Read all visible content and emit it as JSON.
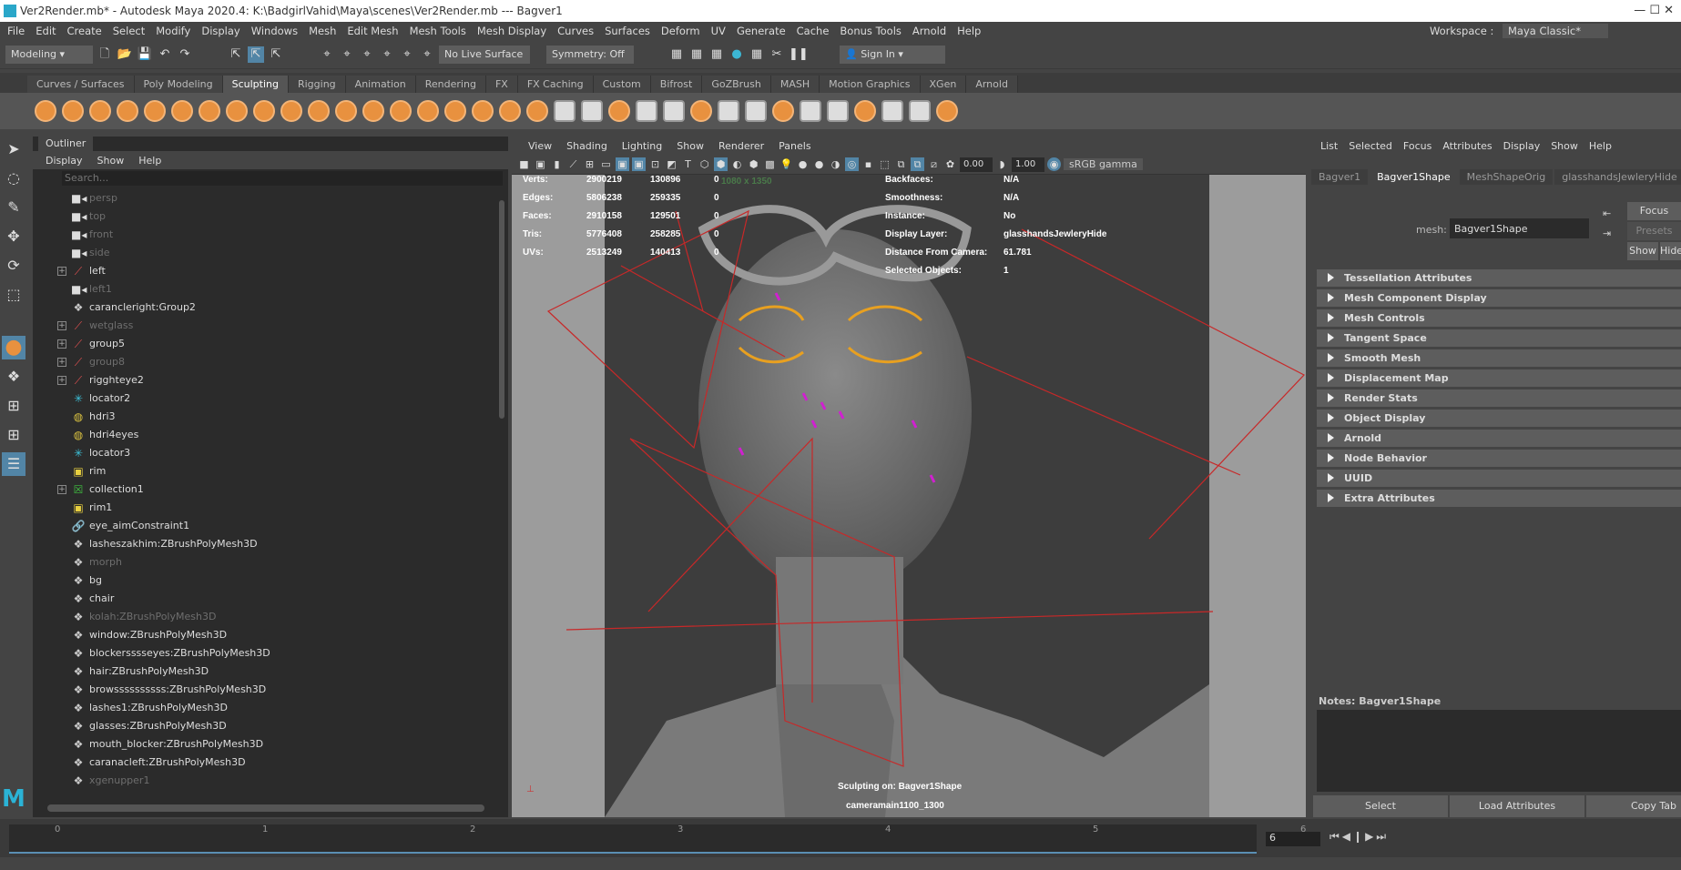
{
  "window": {
    "title": "Ver2Render.mb* - Autodesk Maya 2020.4: K:\\BadgirlVahid\\Maya\\scenes\\Ver2Render.mb   ---   Bagver1"
  },
  "menubar": [
    "File",
    "Edit",
    "Create",
    "Select",
    "Modify",
    "Display",
    "Windows",
    "Mesh",
    "Edit Mesh",
    "Mesh Tools",
    "Mesh Display",
    "Curves",
    "Surfaces",
    "Deform",
    "UV",
    "Generate",
    "Cache",
    "Bonus Tools",
    "Arnold",
    "Help"
  ],
  "workspace": {
    "label": "Workspace :",
    "value": "Maya Classic*"
  },
  "status": {
    "menuset": "Modeling",
    "live_surface": "No Live Surface",
    "symmetry": "Symmetry: Off",
    "sign_in": "Sign In"
  },
  "shelf_tabs": [
    "Curves / Surfaces",
    "Poly Modeling",
    "Sculpting",
    "Rigging",
    "Animation",
    "Rendering",
    "FX",
    "FX Caching",
    "Custom",
    "Bifrost",
    "GoZBrush",
    "MASH",
    "Motion Graphics",
    "XGen",
    "Arnold"
  ],
  "shelf_active": "Sculpting",
  "outliner": {
    "tab": "Outliner",
    "menu": [
      "Display",
      "Show",
      "Help"
    ],
    "search_placeholder": "Search...",
    "items": [
      {
        "label": "persp",
        "icon": "camera",
        "dim": true,
        "exp": false
      },
      {
        "label": "top",
        "icon": "camera",
        "dim": true,
        "exp": false
      },
      {
        "label": "front",
        "icon": "camera",
        "dim": true,
        "exp": false
      },
      {
        "label": "side",
        "icon": "camera",
        "dim": true,
        "exp": false
      },
      {
        "label": "left",
        "icon": "camera-group",
        "dim": false,
        "exp": true
      },
      {
        "label": "left1",
        "icon": "camera",
        "dim": true,
        "exp": false
      },
      {
        "label": "carancleright:Group2",
        "icon": "transform",
        "dim": false,
        "exp": false
      },
      {
        "label": "wetglass",
        "icon": "camera-group",
        "dim": true,
        "exp": true
      },
      {
        "label": "group5",
        "icon": "camera-group",
        "dim": false,
        "exp": true
      },
      {
        "label": "group8",
        "icon": "camera-group",
        "dim": true,
        "exp": true
      },
      {
        "label": "rigghteye2",
        "icon": "camera-group",
        "dim": false,
        "exp": true
      },
      {
        "label": "locator2",
        "icon": "locator",
        "dim": false,
        "exp": false
      },
      {
        "label": "hdri3",
        "icon": "skydome",
        "dim": false,
        "exp": false
      },
      {
        "label": "hdri4eyes",
        "icon": "skydome",
        "dim": false,
        "exp": false
      },
      {
        "label": "locator3",
        "icon": "locator",
        "dim": false,
        "exp": false
      },
      {
        "label": "rim",
        "icon": "light",
        "dim": false,
        "exp": false
      },
      {
        "label": "collection1",
        "icon": "collection",
        "dim": false,
        "exp": true
      },
      {
        "label": "rim1",
        "icon": "light",
        "dim": false,
        "exp": false
      },
      {
        "label": "eye_aimConstraint1",
        "icon": "constraint",
        "dim": false,
        "exp": false
      },
      {
        "label": "lasheszakhim:ZBrushPolyMesh3D",
        "icon": "transform",
        "dim": false,
        "exp": false
      },
      {
        "label": "morph",
        "icon": "transform",
        "dim": true,
        "exp": false
      },
      {
        "label": "bg",
        "icon": "transform",
        "dim": false,
        "exp": false
      },
      {
        "label": "chair",
        "icon": "transform",
        "dim": false,
        "exp": false
      },
      {
        "label": "kolah:ZBrushPolyMesh3D",
        "icon": "transform",
        "dim": true,
        "exp": false
      },
      {
        "label": "window:ZBrushPolyMesh3D",
        "icon": "transform",
        "dim": false,
        "exp": false
      },
      {
        "label": "blockersssseyes:ZBrushPolyMesh3D",
        "icon": "transform",
        "dim": false,
        "exp": false
      },
      {
        "label": "hair:ZBrushPolyMesh3D",
        "icon": "transform",
        "dim": false,
        "exp": false
      },
      {
        "label": "browssssssssss:ZBrushPolyMesh3D",
        "icon": "transform",
        "dim": false,
        "exp": false
      },
      {
        "label": "lashes1:ZBrushPolyMesh3D",
        "icon": "transform",
        "dim": false,
        "exp": false
      },
      {
        "label": "glasses:ZBrushPolyMesh3D",
        "icon": "transform",
        "dim": false,
        "exp": false
      },
      {
        "label": "mouth_blocker:ZBrushPolyMesh3D",
        "icon": "transform",
        "dim": false,
        "exp": false
      },
      {
        "label": "caranacleft:ZBrushPolyMesh3D",
        "icon": "transform",
        "dim": false,
        "exp": false
      },
      {
        "label": "xgenupper1",
        "icon": "transform",
        "dim": true,
        "exp": false
      }
    ]
  },
  "viewport": {
    "menu": [
      "View",
      "Shading",
      "Lighting",
      "Show",
      "Renderer",
      "Panels"
    ],
    "exposure": "0.00",
    "gamma": "1.00",
    "color_space": "sRGB gamma",
    "resolution": "1080 x 1350",
    "stats": [
      [
        "Verts:",
        "2900219",
        "130896",
        "0"
      ],
      [
        "Edges:",
        "5806238",
        "259335",
        "0"
      ],
      [
        "Faces:",
        "2910158",
        "129501",
        "0"
      ],
      [
        "Tris:",
        "5776408",
        "258285",
        "0"
      ],
      [
        "UVs:",
        "2513249",
        "140413",
        "0"
      ]
    ],
    "info": [
      [
        "Backfaces:",
        "N/A"
      ],
      [
        "Smoothness:",
        "N/A"
      ],
      [
        "Instance:",
        "No"
      ],
      [
        "Display Layer:",
        "glasshandsJewleryHide"
      ],
      [
        "Distance From Camera:",
        "61.781"
      ],
      [
        "Selected Objects:",
        "1"
      ]
    ],
    "sculpting_on": "Sculpting on: Bagver1Shape",
    "camera": "cameramain1100_1300"
  },
  "attribute_editor": {
    "menu": [
      "List",
      "Selected",
      "Focus",
      "Attributes",
      "Display",
      "Show",
      "Help"
    ],
    "tabs": [
      "Bagver1",
      "Bagver1Shape",
      "MeshShapeOrig",
      "glasshandsJewleryHide"
    ],
    "active_tab": "Bagver1Shape",
    "mesh_label": "mesh:",
    "mesh_value": "Bagver1Shape",
    "focus": "Focus",
    "presets": "Presets",
    "show": "Show",
    "hide": "Hide",
    "sections": [
      "Tessellation Attributes",
      "Mesh Component Display",
      "Mesh Controls",
      "Tangent Space",
      "Smooth Mesh",
      "Displacement Map",
      "Render Stats",
      "Object Display",
      "Arnold",
      "Node Behavior",
      "UUID",
      "Extra Attributes"
    ],
    "notes": "Notes:  Bagver1Shape",
    "buttons": [
      "Select",
      "Load Attributes",
      "Copy Tab"
    ]
  },
  "timeline": {
    "ticks": [
      "0",
      "1",
      "2",
      "3",
      "4",
      "5",
      "6"
    ],
    "current_frame": "6",
    "end_frame": "6"
  },
  "colors": {
    "accent": "#5285a6",
    "shelf_orange": "#e8913f",
    "wire_red": "#c82828"
  }
}
